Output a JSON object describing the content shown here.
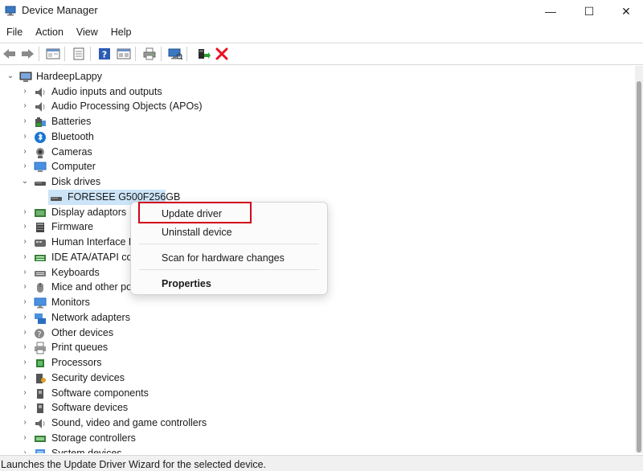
{
  "window": {
    "title": "Device Manager",
    "minimize_glyph": "—",
    "maximize_glyph": "☐",
    "close_glyph": "✕"
  },
  "menu": [
    "File",
    "Action",
    "View",
    "Help"
  ],
  "toolbar": {
    "icons": [
      "back-arrow-icon",
      "forward-arrow-icon",
      "properties-icon",
      "driver-details-icon",
      "help-icon",
      "view-icon",
      "print-icon",
      "scan-hardware-icon",
      "add-driver-icon",
      "uninstall-icon"
    ]
  },
  "tree": {
    "root": "HardeepLappy",
    "categories": [
      {
        "label": "Audio inputs and outputs",
        "icon": "speaker-icon",
        "expanded": false
      },
      {
        "label": "Audio Processing Objects (APOs)",
        "icon": "speaker-icon",
        "expanded": false
      },
      {
        "label": "Batteries",
        "icon": "battery-icon",
        "expanded": false
      },
      {
        "label": "Bluetooth",
        "icon": "bluetooth-icon",
        "expanded": false
      },
      {
        "label": "Cameras",
        "icon": "camera-icon",
        "expanded": false
      },
      {
        "label": "Computer",
        "icon": "computer-icon",
        "expanded": false
      },
      {
        "label": "Disk drives",
        "icon": "disk-drive-icon",
        "expanded": true
      },
      {
        "label": "Display adaptors",
        "icon": "display-adapter-icon",
        "expanded": false
      },
      {
        "label": "Firmware",
        "icon": "firmware-icon",
        "expanded": false
      },
      {
        "label": "Human Interface D",
        "icon": "hid-icon",
        "expanded": false
      },
      {
        "label": "IDE ATA/ATAPI cont",
        "icon": "ide-icon",
        "expanded": false
      },
      {
        "label": "Keyboards",
        "icon": "keyboard-icon",
        "expanded": false
      },
      {
        "label": "Mice and other po",
        "icon": "mouse-icon",
        "expanded": false
      },
      {
        "label": "Monitors",
        "icon": "monitor-icon",
        "expanded": false
      },
      {
        "label": "Network adapters",
        "icon": "network-adapter-icon",
        "expanded": false
      },
      {
        "label": "Other devices",
        "icon": "other-devices-icon",
        "expanded": false
      },
      {
        "label": "Print queues",
        "icon": "printer-icon",
        "expanded": false
      },
      {
        "label": "Processors",
        "icon": "processor-icon",
        "expanded": false
      },
      {
        "label": "Security devices",
        "icon": "security-device-icon",
        "expanded": false
      },
      {
        "label": "Software components",
        "icon": "software-component-icon",
        "expanded": false
      },
      {
        "label": "Software devices",
        "icon": "software-device-icon",
        "expanded": false
      },
      {
        "label": "Sound, video and game controllers",
        "icon": "sound-icon",
        "expanded": false
      },
      {
        "label": "Storage controllers",
        "icon": "storage-controller-icon",
        "expanded": false
      },
      {
        "label": "System devices",
        "icon": "system-devices-icon",
        "expanded": false
      }
    ],
    "disk_child": "FORESEE G500F256GB"
  },
  "context_menu": {
    "update_driver": "Update driver",
    "uninstall_device": "Uninstall device",
    "scan_hardware": "Scan for hardware changes",
    "properties": "Properties"
  },
  "status": {
    "text": "Launches the Update Driver Wizard for the selected device."
  },
  "colors": {
    "selection": "#cce4f7",
    "highlight_border": "#d0021b",
    "uninstall_red": "#e81123"
  }
}
